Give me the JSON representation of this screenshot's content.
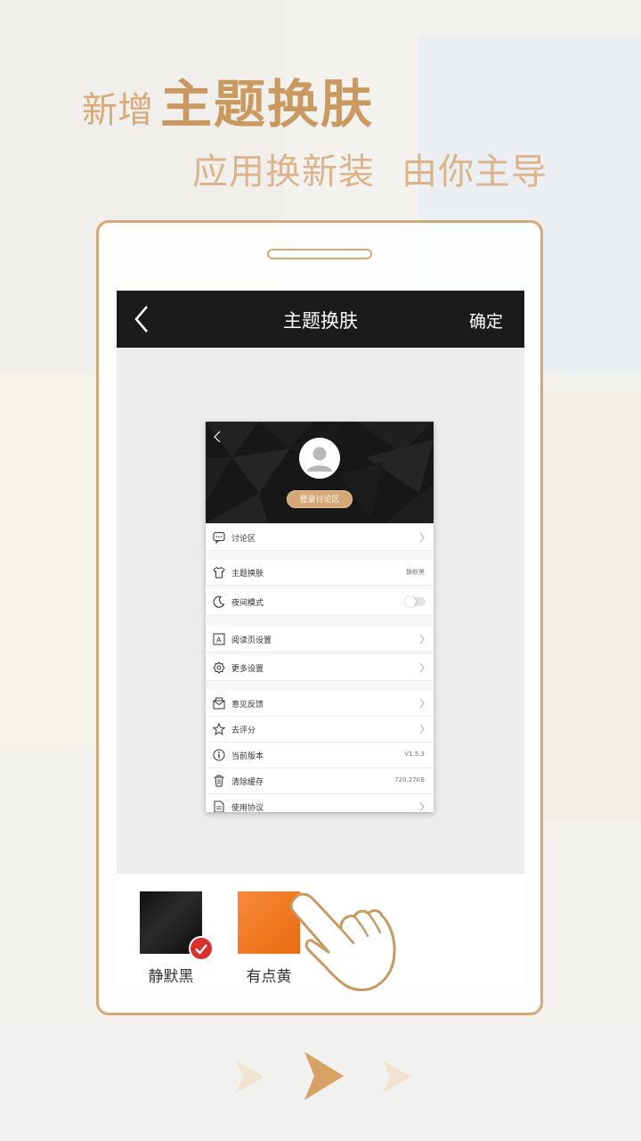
{
  "promo": {
    "headline_prefix": "新增",
    "headline_main": "主题换肤",
    "subline_a": "应用换新装",
    "subline_b": "由你主导"
  },
  "app": {
    "topbar": {
      "title": "主题换肤",
      "confirm": "确定"
    },
    "preview": {
      "login_button": "登录讨论区",
      "rows": [
        {
          "label": "讨论区",
          "value": "",
          "icon": "chat-icon"
        },
        {
          "label": "主题换肤",
          "value": "静默黑",
          "icon": "shirt-icon"
        },
        {
          "label": "夜间模式",
          "value": "",
          "icon": "moon-icon"
        },
        {
          "label": "阅读页设置",
          "value": "",
          "icon": "text-settings-icon"
        },
        {
          "label": "更多设置",
          "value": "",
          "icon": "gear-icon"
        },
        {
          "label": "意见反馈",
          "value": "",
          "icon": "feedback-icon"
        },
        {
          "label": "去评分",
          "value": "",
          "icon": "star-icon"
        },
        {
          "label": "当前版本",
          "value": "V1.5.3",
          "icon": "info-icon"
        },
        {
          "label": "清除缓存",
          "value": "720.27KB",
          "icon": "trash-icon"
        },
        {
          "label": "使用协议",
          "value": "",
          "icon": "document-icon"
        }
      ]
    },
    "themes": [
      {
        "name": "静默黑",
        "color": "#1a1a1a",
        "selected": true
      },
      {
        "name": "有点黄",
        "color": "#f17a24",
        "selected": false
      }
    ]
  },
  "colors": {
    "accent": "#d7a877",
    "check": "#d9322c",
    "topbar": "#1b1b1b"
  }
}
